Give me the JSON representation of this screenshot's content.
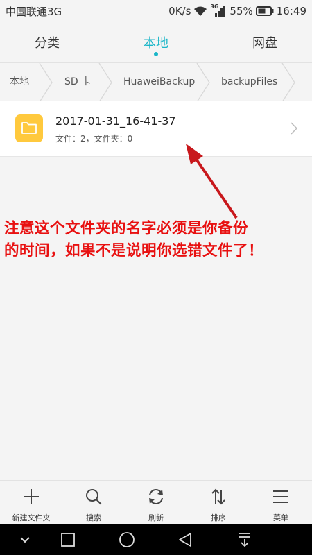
{
  "status_bar": {
    "carrier": "中国联通3G",
    "speed": "0K/s",
    "network_badge": "3G",
    "battery": "55%",
    "time": "16:49",
    "icons": [
      "wifi-icon",
      "signal-icon",
      "battery-icon"
    ]
  },
  "tabs": [
    {
      "label": "分类",
      "active": false
    },
    {
      "label": "本地",
      "active": true
    },
    {
      "label": "网盘",
      "active": false
    }
  ],
  "breadcrumb": [
    "本地",
    "SD 卡",
    "HuaweiBackup",
    "backupFiles"
  ],
  "files": [
    {
      "name": "2017-01-31_16-41-37",
      "meta": "文件：2，文件夹：0",
      "icon": "folder-icon"
    }
  ],
  "annotation": {
    "line1": "注意这个文件夹的名字必须是你备份",
    "line2": "的时间，如果不是说明你选错文件了！"
  },
  "toolbar": [
    {
      "label": "新建文件夹",
      "icon": "plus-icon"
    },
    {
      "label": "搜索",
      "icon": "search-icon"
    },
    {
      "label": "刷新",
      "icon": "refresh-icon"
    },
    {
      "label": "排序",
      "icon": "sort-icon"
    },
    {
      "label": "菜单",
      "icon": "menu-icon"
    }
  ],
  "navbar": [
    "chevron-down-icon",
    "recents-icon",
    "home-icon",
    "back-icon",
    "notification-pull-icon"
  ],
  "colors": {
    "accent": "#1bb6c8",
    "folder": "#ffc93d",
    "annotation": "#e81010",
    "navbar": "#000000"
  }
}
